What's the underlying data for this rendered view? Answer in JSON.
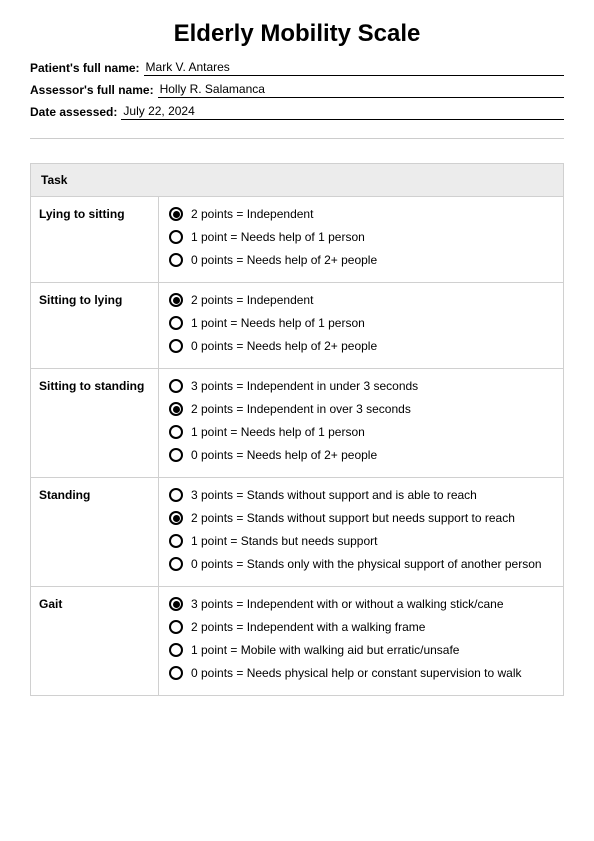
{
  "title": "Elderly Mobility Scale",
  "fields": {
    "patient_label": "Patient's full name:",
    "patient_value": "Mark V. Antares",
    "assessor_label": "Assessor's full name:",
    "assessor_value": "Holly R. Salamanca",
    "date_label": "Date assessed:",
    "date_value": "July 22, 2024"
  },
  "task_header": "Task",
  "tasks": [
    {
      "name": "Lying to sitting",
      "options": [
        {
          "label": "2 points = Independent",
          "checked": true
        },
        {
          "label": "1 point = Needs help of 1 person",
          "checked": false
        },
        {
          "label": "0 points = Needs help of 2+ people",
          "checked": false
        }
      ]
    },
    {
      "name": "Sitting to lying",
      "options": [
        {
          "label": "2 points = Independent",
          "checked": true
        },
        {
          "label": "1 point = Needs help of 1 person",
          "checked": false
        },
        {
          "label": "0 points = Needs help of 2+ people",
          "checked": false
        }
      ]
    },
    {
      "name": "Sitting to standing",
      "options": [
        {
          "label": "3 points = Independent in under 3 seconds",
          "checked": false
        },
        {
          "label": "2 points = Independent in over 3 seconds",
          "checked": true
        },
        {
          "label": "1 point = Needs help of 1 person",
          "checked": false
        },
        {
          "label": "0 points = Needs help of 2+ people",
          "checked": false
        }
      ]
    },
    {
      "name": "Standing",
      "options": [
        {
          "label": "3 points = Stands without support and is able to reach",
          "checked": false
        },
        {
          "label": "2 points = Stands without support but needs support to reach",
          "checked": true
        },
        {
          "label": "1 point = Stands but needs support",
          "checked": false
        },
        {
          "label": "0 points = Stands only with the physical support of another person",
          "checked": false
        }
      ]
    },
    {
      "name": "Gait",
      "options": [
        {
          "label": "3 points = Independent with or without a walking stick/cane",
          "checked": true
        },
        {
          "label": "2 points = Independent with a walking frame",
          "checked": false
        },
        {
          "label": "1 point = Mobile with walking aid but erratic/unsafe",
          "checked": false
        },
        {
          "label": "0 points = Needs physical help or constant supervision to walk",
          "checked": false
        }
      ]
    }
  ]
}
